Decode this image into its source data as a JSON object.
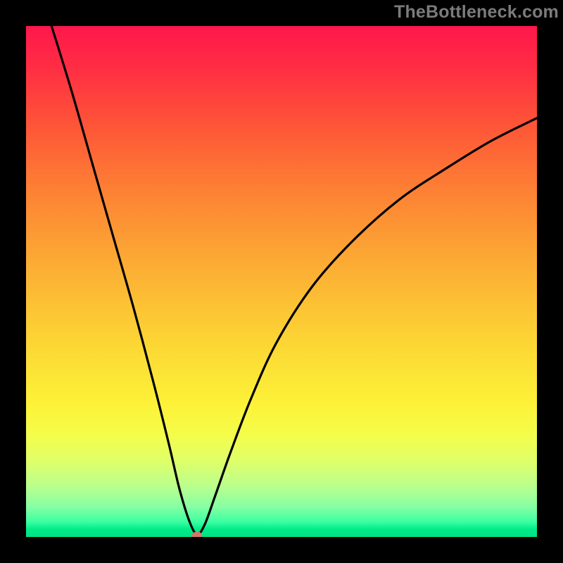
{
  "watermark": "TheBottleneck.com",
  "colors": {
    "frame": "#000000",
    "curve": "#000000",
    "marker": "#d0786b",
    "gradient_top": "#ff174c",
    "gradient_bottom": "#00e285"
  },
  "chart_data": {
    "type": "line",
    "title": "",
    "xlabel": "",
    "ylabel": "",
    "xlim": [
      0,
      1
    ],
    "ylim": [
      0,
      1
    ],
    "grid": false,
    "legend": false,
    "background": "red-yellow-green vertical gradient (bottleneck heatmap)",
    "notes": "V-shaped bottleneck curve; minimum near x≈0.33. Left branch reaches y≈1 at x≈0.05; right branch rises to y≈0.82 at x=1. Marker indicates optimal (no-bottleneck) point.",
    "series": [
      {
        "name": "bottleneck-curve",
        "x": [
          0.05,
          0.09,
          0.13,
          0.17,
          0.21,
          0.25,
          0.28,
          0.3,
          0.32,
          0.335,
          0.35,
          0.37,
          0.4,
          0.44,
          0.49,
          0.56,
          0.64,
          0.73,
          0.82,
          0.91,
          1.0
        ],
        "y": [
          1.0,
          0.87,
          0.73,
          0.59,
          0.45,
          0.3,
          0.18,
          0.095,
          0.03,
          0.005,
          0.025,
          0.08,
          0.165,
          0.27,
          0.38,
          0.49,
          0.58,
          0.66,
          0.72,
          0.775,
          0.82
        ]
      }
    ],
    "markers": [
      {
        "name": "optimal-point",
        "x": 0.335,
        "y": 0.003
      }
    ]
  }
}
